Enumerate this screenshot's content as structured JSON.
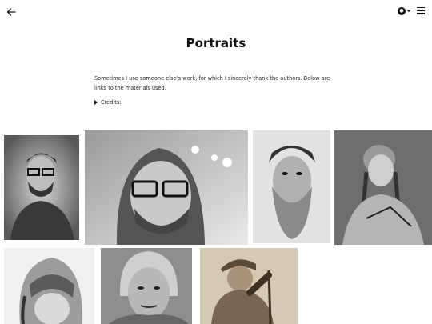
{
  "header": {
    "back_icon": "arrow-left-icon",
    "language_icon": "globe-icon",
    "language_badge": "●",
    "menu_icon": "hamburger-icon"
  },
  "page": {
    "title": "Portraits",
    "intro": "Sometimes I use someone else’s work, for which I sincerely thank the authors. Below are links to the materials used.",
    "credits_label": "Credits:"
  },
  "gallery": {
    "images": [
      {
        "subject": "man with glasses and beard"
      },
      {
        "subject": "bearded man in hood with glasses"
      },
      {
        "subject": "old man with long beard"
      },
      {
        "subject": "woman with braids"
      },
      {
        "subject": "girl with bangs"
      },
      {
        "subject": "older woman"
      },
      {
        "subject": "man with raised arm"
      }
    ]
  },
  "colors": {
    "background": "#ffffff",
    "text": "#111111"
  }
}
